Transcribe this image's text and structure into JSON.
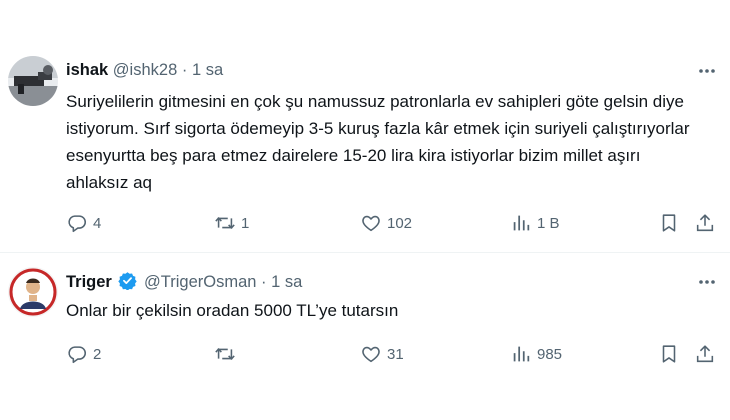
{
  "tweets": [
    {
      "name": "ishak",
      "handle": "@ishk28",
      "dot": "·",
      "time": "1 sa",
      "text": "Suriyelilerin gitmesini en çok şu namussuz patronlarla ev sahipleri göte gelsin diye istiyorum. Sırf sigorta ödemeyip 3-5 kuruş fazla kâr etmek için suriyeli çalıştırıyorlar esenyurtta beş para etmez dairelere 15-20 lira kira istiyorlar bizim millet aşırı ahlaksız aq",
      "replies": "4",
      "retweets": "1",
      "likes": "102",
      "views": "1 B"
    },
    {
      "name": "Triger",
      "verified": true,
      "handle": "@TrigerOsman",
      "dot": "·",
      "time": "1 sa",
      "text": "Onlar bir çekilsin oradan 5000 TL’ye tutarsın",
      "replies": "2",
      "retweets": "",
      "likes": "31",
      "views": "985"
    }
  ],
  "colors": {
    "text": "#0f1419",
    "secondary": "#536471",
    "verified": "#1d9bf0",
    "divider": "#eff3f4"
  },
  "icons": [
    "more-icon",
    "reply-icon",
    "retweet-icon",
    "like-icon",
    "views-icon",
    "bookmark-icon",
    "share-icon",
    "verified-badge-icon"
  ]
}
